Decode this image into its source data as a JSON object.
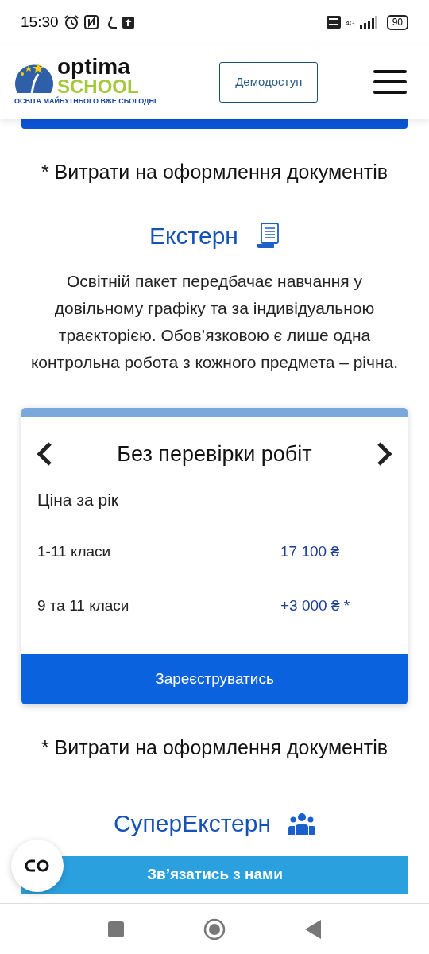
{
  "status_bar": {
    "time": "15:30",
    "network": "4G",
    "battery": "90"
  },
  "header": {
    "logo": {
      "word_1": "optima",
      "word_2": "SCHOOL",
      "tagline": "ОСВІТА МАЙБУТНЬОГО ВЖЕ СЬОГОДНІ"
    },
    "demo_button": "Демодоступ"
  },
  "footnote_top": "* Витрати на оформлення документів",
  "section": {
    "title": "Екстерн",
    "description": "Освітній пакет передбачає навчання у довільному графіку та за індивідуальною траєкторією. Обов’язковою є лише одна контрольна робота з кожного предмета – річна."
  },
  "plan_card": {
    "title": "Без перевірки робіт",
    "price_label": "Ціна за рік",
    "rows": [
      {
        "label": "1-11 класи",
        "price": "17 100 ₴"
      },
      {
        "label": "9 та 11 класи",
        "price": "+3 000 ₴ *"
      }
    ],
    "button": "Зареєструватись"
  },
  "footnote_bottom": "* Витрати на оформлення документів",
  "next_section": {
    "title": "СуперЕкстерн"
  },
  "contact_bar": "Зв’язатись з нами"
}
